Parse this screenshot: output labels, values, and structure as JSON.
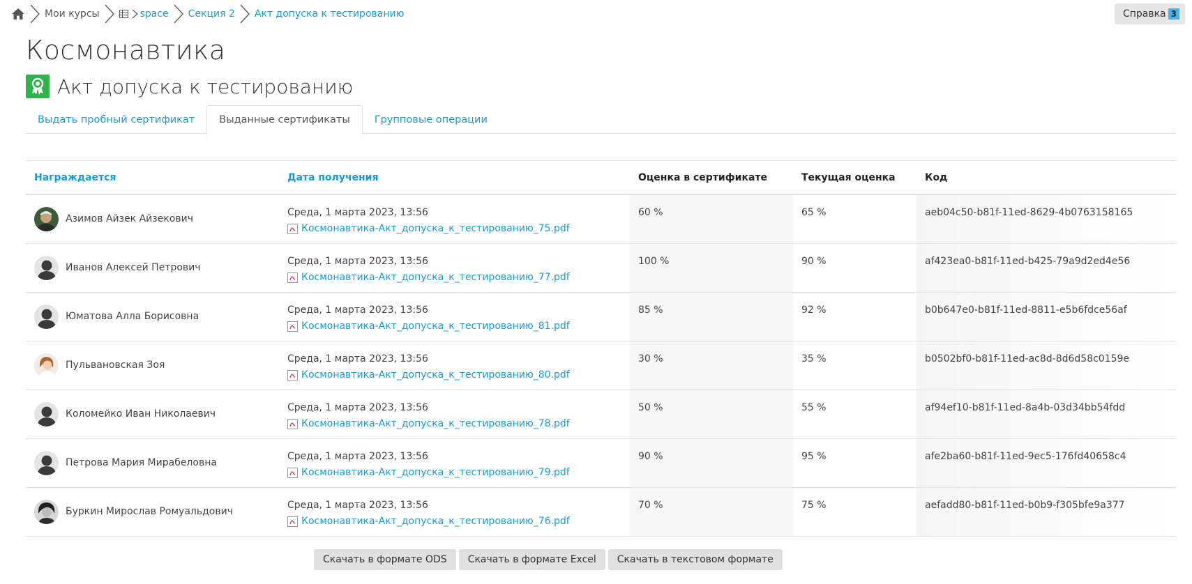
{
  "breadcrumb": {
    "my_courses": "Мои курсы",
    "course": "space",
    "section": "Секция 2",
    "activity": "Акт допуска к тестированию"
  },
  "help": {
    "label": "Справка",
    "badge": "3"
  },
  "course_title": "Космонавтика",
  "activity_title": "Акт допуска к тестированию",
  "tabs": [
    {
      "label": "Выдать пробный сертификат",
      "active": false
    },
    {
      "label": "Выданные сертификаты",
      "active": true
    },
    {
      "label": "Групповые операции",
      "active": false
    }
  ],
  "table": {
    "headers": {
      "awardee": "Награждается",
      "date": "Дата получения",
      "cert_grade": "Оценка в сертификате",
      "current_grade": "Текущая оценка",
      "code": "Код"
    },
    "rows": [
      {
        "name": "Азимов Айзек Айзекович",
        "avatar": "photo",
        "date": "Среда, 1 марта 2023, 13:56",
        "file": "Космонавтика-Акт_допуска_к_тестированию_75.pdf",
        "cert_grade": "60 %",
        "current_grade": "65 %",
        "code": "aeb04c50-b81f-11ed-8629-4b0763158165"
      },
      {
        "name": "Иванов Алексей Петрович",
        "avatar": "default",
        "date": "Среда, 1 марта 2023, 13:56",
        "file": "Космонавтика-Акт_допуска_к_тестированию_77.pdf",
        "cert_grade": "100 %",
        "current_grade": "90 %",
        "code": "af423ea0-b81f-11ed-b425-79a9d2ed4e56"
      },
      {
        "name": "Юматова Алла Борисовна",
        "avatar": "default",
        "date": "Среда, 1 марта 2023, 13:56",
        "file": "Космонавтика-Акт_допуска_к_тестированию_81.pdf",
        "cert_grade": "85 %",
        "current_grade": "92 %",
        "code": "b0b647e0-b81f-11ed-8811-e5b6fdce56af"
      },
      {
        "name": "Пульвановская Зоя",
        "avatar": "photo-female",
        "date": "Среда, 1 марта 2023, 13:56",
        "file": "Космонавтика-Акт_допуска_к_тестированию_80.pdf",
        "cert_grade": "30 %",
        "current_grade": "35 %",
        "code": "b0502bf0-b81f-11ed-ac8d-8d6d58c0159e"
      },
      {
        "name": "Коломейко Иван Николаевич",
        "avatar": "default",
        "date": "Среда, 1 марта 2023, 13:56",
        "file": "Космонавтика-Акт_допуска_к_тестированию_78.pdf",
        "cert_grade": "50 %",
        "current_grade": "55 %",
        "code": "af94ef10-b81f-11ed-8a4b-03d34bb54fdd"
      },
      {
        "name": "Петрова Мария Мирабеловна",
        "avatar": "default",
        "date": "Среда, 1 марта 2023, 13:56",
        "file": "Космонавтика-Акт_допуска_к_тестированию_79.pdf",
        "cert_grade": "90 %",
        "current_grade": "95 %",
        "code": "afe2ba60-b81f-11ed-9ec5-176fd40658c4"
      },
      {
        "name": "Буркин Мирослав Ромуальдович",
        "avatar": "photo-bw",
        "date": "Среда, 1 марта 2023, 13:56",
        "file": "Космонавтика-Акт_допуска_к_тестированию_76.pdf",
        "cert_grade": "70 %",
        "current_grade": "75 %",
        "code": "aefadd80-b81f-11ed-b0b9-f305bfe9a377"
      }
    ]
  },
  "downloads": {
    "ods": "Скачать в формате ODS",
    "excel": "Скачать в формате Excel",
    "text": "Скачать в текстовом формате"
  },
  "colors": {
    "link": "#1a9bd7",
    "activity_icon": "#2db34a",
    "button_bg": "#e0e0e0",
    "badge": "#4bb3e0"
  }
}
